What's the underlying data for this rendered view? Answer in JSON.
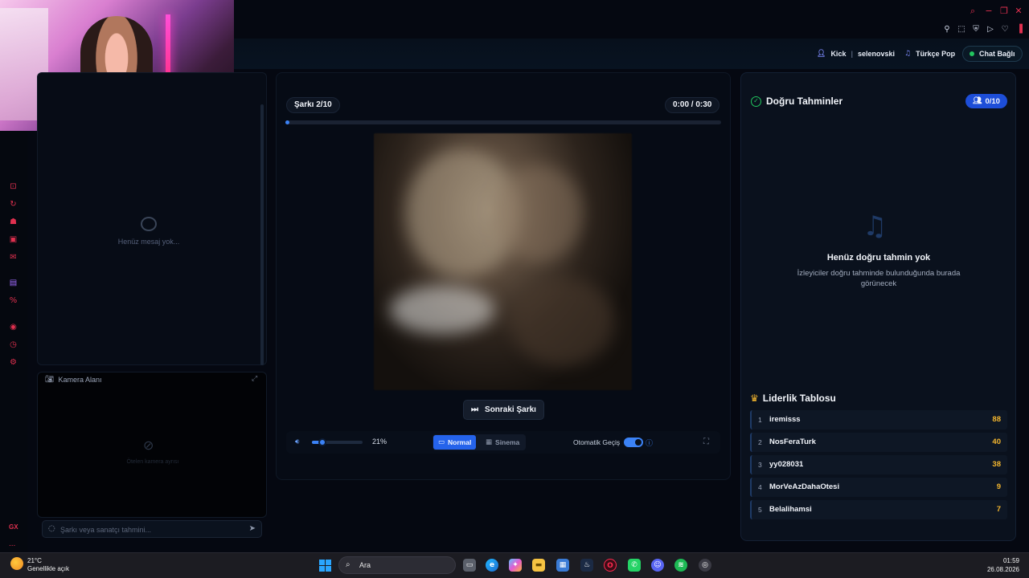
{
  "topbar": {
    "icons": [
      "search-icon",
      "minimize-icon",
      "restore-icon",
      "close-icon"
    ],
    "toolbar_icons": [
      "pin-icon",
      "screenshot-icon",
      "shield-icon",
      "play-icon",
      "heart-icon",
      "menu-icon"
    ]
  },
  "header": {
    "platform_label": "Kick",
    "channel": "selenovski",
    "playlist": "Türkçe Pop",
    "chat_status": "Chat Bağlı",
    "status_color": "#22c55e"
  },
  "chat": {
    "empty_text": "Henüz mesaj yok...",
    "input_placeholder": "Şarkı veya sanatçı tahmini..."
  },
  "camera": {
    "title": "Kamera Alanı",
    "off_text": "Ötelen kamera ayrısı"
  },
  "player": {
    "song_counter": "Şarkı 2/10",
    "time": "0:00 / 0:30",
    "progress": 0.01,
    "next_label": "Sonraki Şarkı",
    "volume_value": "21%",
    "volume": 0.21,
    "modes": [
      {
        "label": "Normal",
        "active": true
      },
      {
        "label": "Sinema",
        "active": false
      }
    ],
    "auto_label": "Otomatik Geçiş",
    "auto_enabled": true,
    "accent": "#3b82f6"
  },
  "guesses": {
    "title": "Doğru Tahminler",
    "count": "0/10",
    "empty_title": "Henüz doğru tahmin yok",
    "empty_sub": "İzleyiciler doğru tahminde bulunduğunda burada görünecek"
  },
  "leaderboard": {
    "title": "Liderlik Tablosu",
    "rows": [
      {
        "rank": "1",
        "name": "iremisss",
        "score": "88"
      },
      {
        "rank": "2",
        "name": "NosFeraTurk",
        "score": "40"
      },
      {
        "rank": "3",
        "name": "yy028031",
        "score": "38"
      },
      {
        "rank": "4",
        "name": "MorVeAzDahaOtesi",
        "score": "9"
      },
      {
        "rank": "5",
        "name": "Belalihamsi",
        "score": "7"
      }
    ]
  },
  "sidebar": {
    "icons": [
      "gamepad-icon",
      "refresh-icon",
      "robot-icon",
      "monitor-icon",
      "mail-icon",
      "twitch-icon",
      "percent-icon",
      "play-circle-icon",
      "clock-icon",
      "settings-icon"
    ],
    "brand": "GX",
    "more": "..."
  },
  "taskbar": {
    "temperature": "21°C",
    "weather": "Genellikle açık",
    "search_label": "Ara",
    "time": "01:59",
    "date": "26.08.2026",
    "apps": [
      "file-explorer-icon",
      "edge-icon",
      "copilot-icon",
      "folder-icon",
      "store-icon",
      "steam-icon",
      "opera-gx-icon",
      "whatsapp-icon",
      "discord-icon",
      "spotify-icon",
      "chrome-icon"
    ]
  }
}
